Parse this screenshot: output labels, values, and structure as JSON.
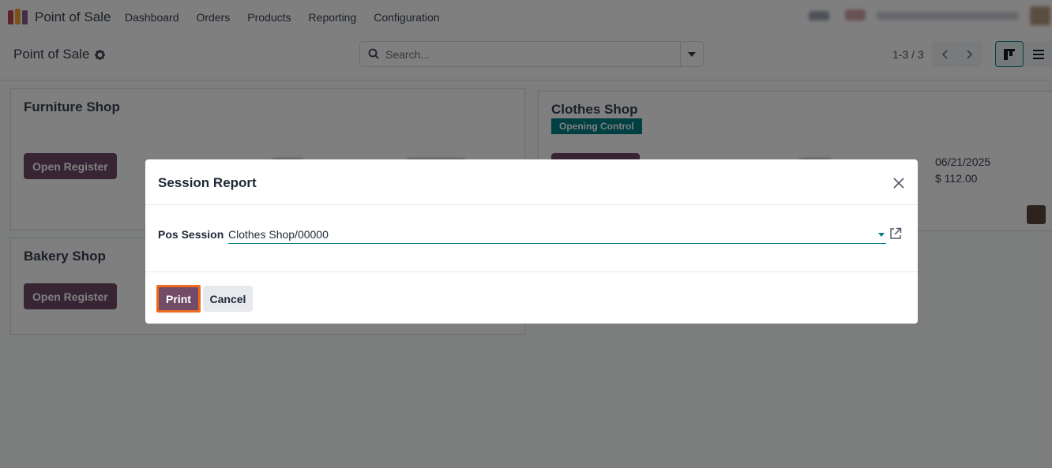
{
  "navbar": {
    "app_name": "Point of Sale",
    "menu": [
      "Dashboard",
      "Orders",
      "Products",
      "Reporting",
      "Configuration"
    ]
  },
  "control_panel": {
    "breadcrumb": "Point of Sale",
    "search_placeholder": "Search...",
    "pager": "1-3 / 3"
  },
  "cards": {
    "furniture": {
      "title": "Furniture Shop",
      "button": "Open Register"
    },
    "clothes": {
      "title": "Clothes Shop",
      "badge": "Opening Control",
      "date": "06/21/2025",
      "amount": "$ 112.00"
    },
    "bakery": {
      "title": "Bakery Shop",
      "button": "Open Register"
    }
  },
  "dialog": {
    "title": "Session Report",
    "field_label": "Pos Session",
    "field_value": "Clothes Shop/00000",
    "print_label": "Print",
    "cancel_label": "Cancel"
  },
  "colors": {
    "brand": "#714b67",
    "accent": "#017e84",
    "highlight": "#f06a1d"
  },
  "icons": [
    "app-logo-icon",
    "gear-icon",
    "search-icon",
    "caret-down-icon",
    "chevron-left-icon",
    "chevron-right-icon",
    "kanban-view-icon",
    "list-view-icon",
    "close-icon",
    "external-link-icon"
  ]
}
